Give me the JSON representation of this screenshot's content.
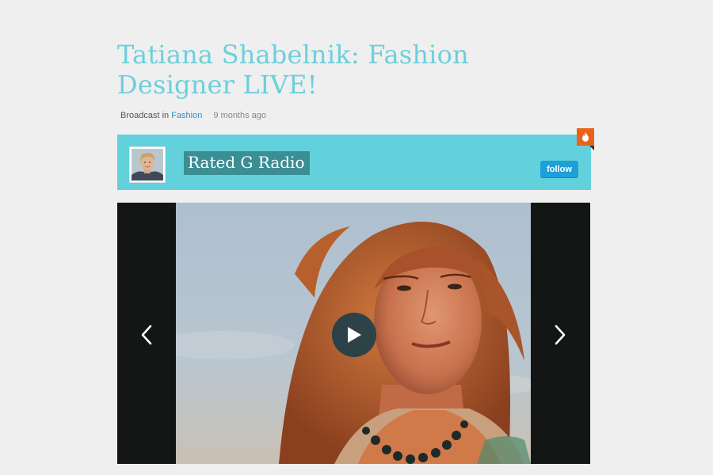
{
  "broadcast": {
    "title": "Tatiana Shabelnik: Fashion Designer LIVE!",
    "meta_prefix": "Broadcast in",
    "category": "Fashion",
    "time_ago": "9 months ago"
  },
  "channel": {
    "name": "Rated G Radio",
    "follow_label": "follow",
    "bar_color": "#63d1dc",
    "badge_icon": "flame-icon"
  },
  "player": {
    "prev_icon": "chevron-left-icon",
    "next_icon": "chevron-right-icon",
    "play_icon": "play-icon"
  }
}
